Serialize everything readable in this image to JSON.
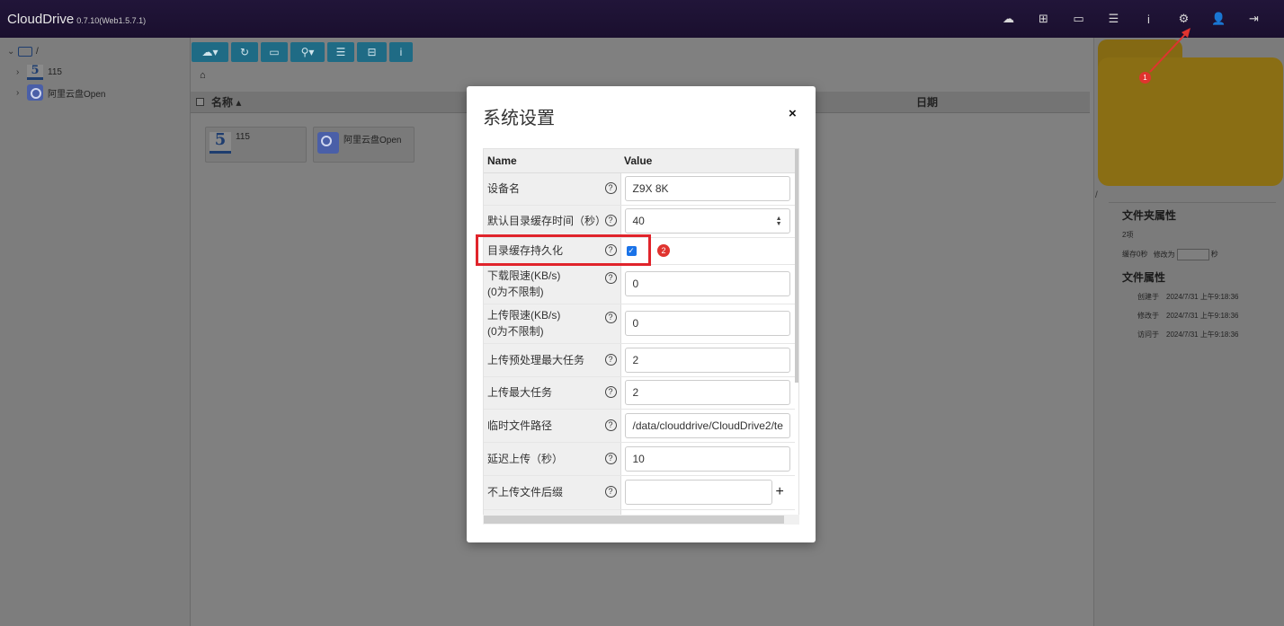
{
  "app": {
    "title": "CloudDrive",
    "version": "0.7.10(Web1.5.7.1)"
  },
  "top_icons": [
    "cloud-icon",
    "sitemap-icon",
    "monitor-icon",
    "task-list-icon",
    "info-icon",
    "settings-icon",
    "add-user-icon",
    "logout-icon"
  ],
  "tree": {
    "root": "/",
    "items": [
      {
        "label": "115",
        "icon": "115-logo-icon"
      },
      {
        "label": "阿里云盘Open",
        "icon": "aliyun-logo-icon"
      }
    ]
  },
  "breadcrumb": "⌂",
  "list": {
    "col_name": "名称",
    "col_date": "日期",
    "files": [
      {
        "label": "115",
        "icon": "115-logo-icon"
      },
      {
        "label": "阿里云盘Open",
        "icon": "aliyun-logo-icon"
      }
    ]
  },
  "right_panel": {
    "path": "/",
    "folder_props_title": "文件夹属性",
    "count": "2项",
    "cache_label": "缓存0秒",
    "modify_label": "修改为",
    "seconds_unit": "秒",
    "file_props_title": "文件属性",
    "created_label": "创建于",
    "created": "2024/7/31 上午9:18:36",
    "modified_label": "修改于",
    "modified": "2024/7/31 上午9:18:36",
    "accessed_label": "访问于",
    "accessed": "2024/7/31 上午9:18:36"
  },
  "modal": {
    "title": "系统设置",
    "close": "×",
    "col_name": "Name",
    "col_value": "Value",
    "rows": [
      {
        "name": "设备名",
        "value": "Z9X 8K"
      },
      {
        "name": "默认目录缓存时间（秒）",
        "value": "40"
      },
      {
        "name": "目录缓存持久化",
        "checked": true
      },
      {
        "name": "下载限速(KB/s)",
        "name2": "(0为不限制)",
        "value": "0"
      },
      {
        "name": "上传限速(KB/s)",
        "name2": "(0为不限制)",
        "value": "0"
      },
      {
        "name": "上传预处理最大任务",
        "value": "2"
      },
      {
        "name": "上传最大任务",
        "value": "2"
      },
      {
        "name": "临时文件路径",
        "value": "/data/clouddrive/CloudDrive2/te"
      },
      {
        "name": "延迟上传（秒）",
        "value": "10"
      },
      {
        "name": "不上传文件后缀",
        "value": "",
        "add": "+"
      }
    ]
  },
  "annotations": {
    "step1": "1",
    "step2": "2",
    "color": "#e0342f"
  }
}
